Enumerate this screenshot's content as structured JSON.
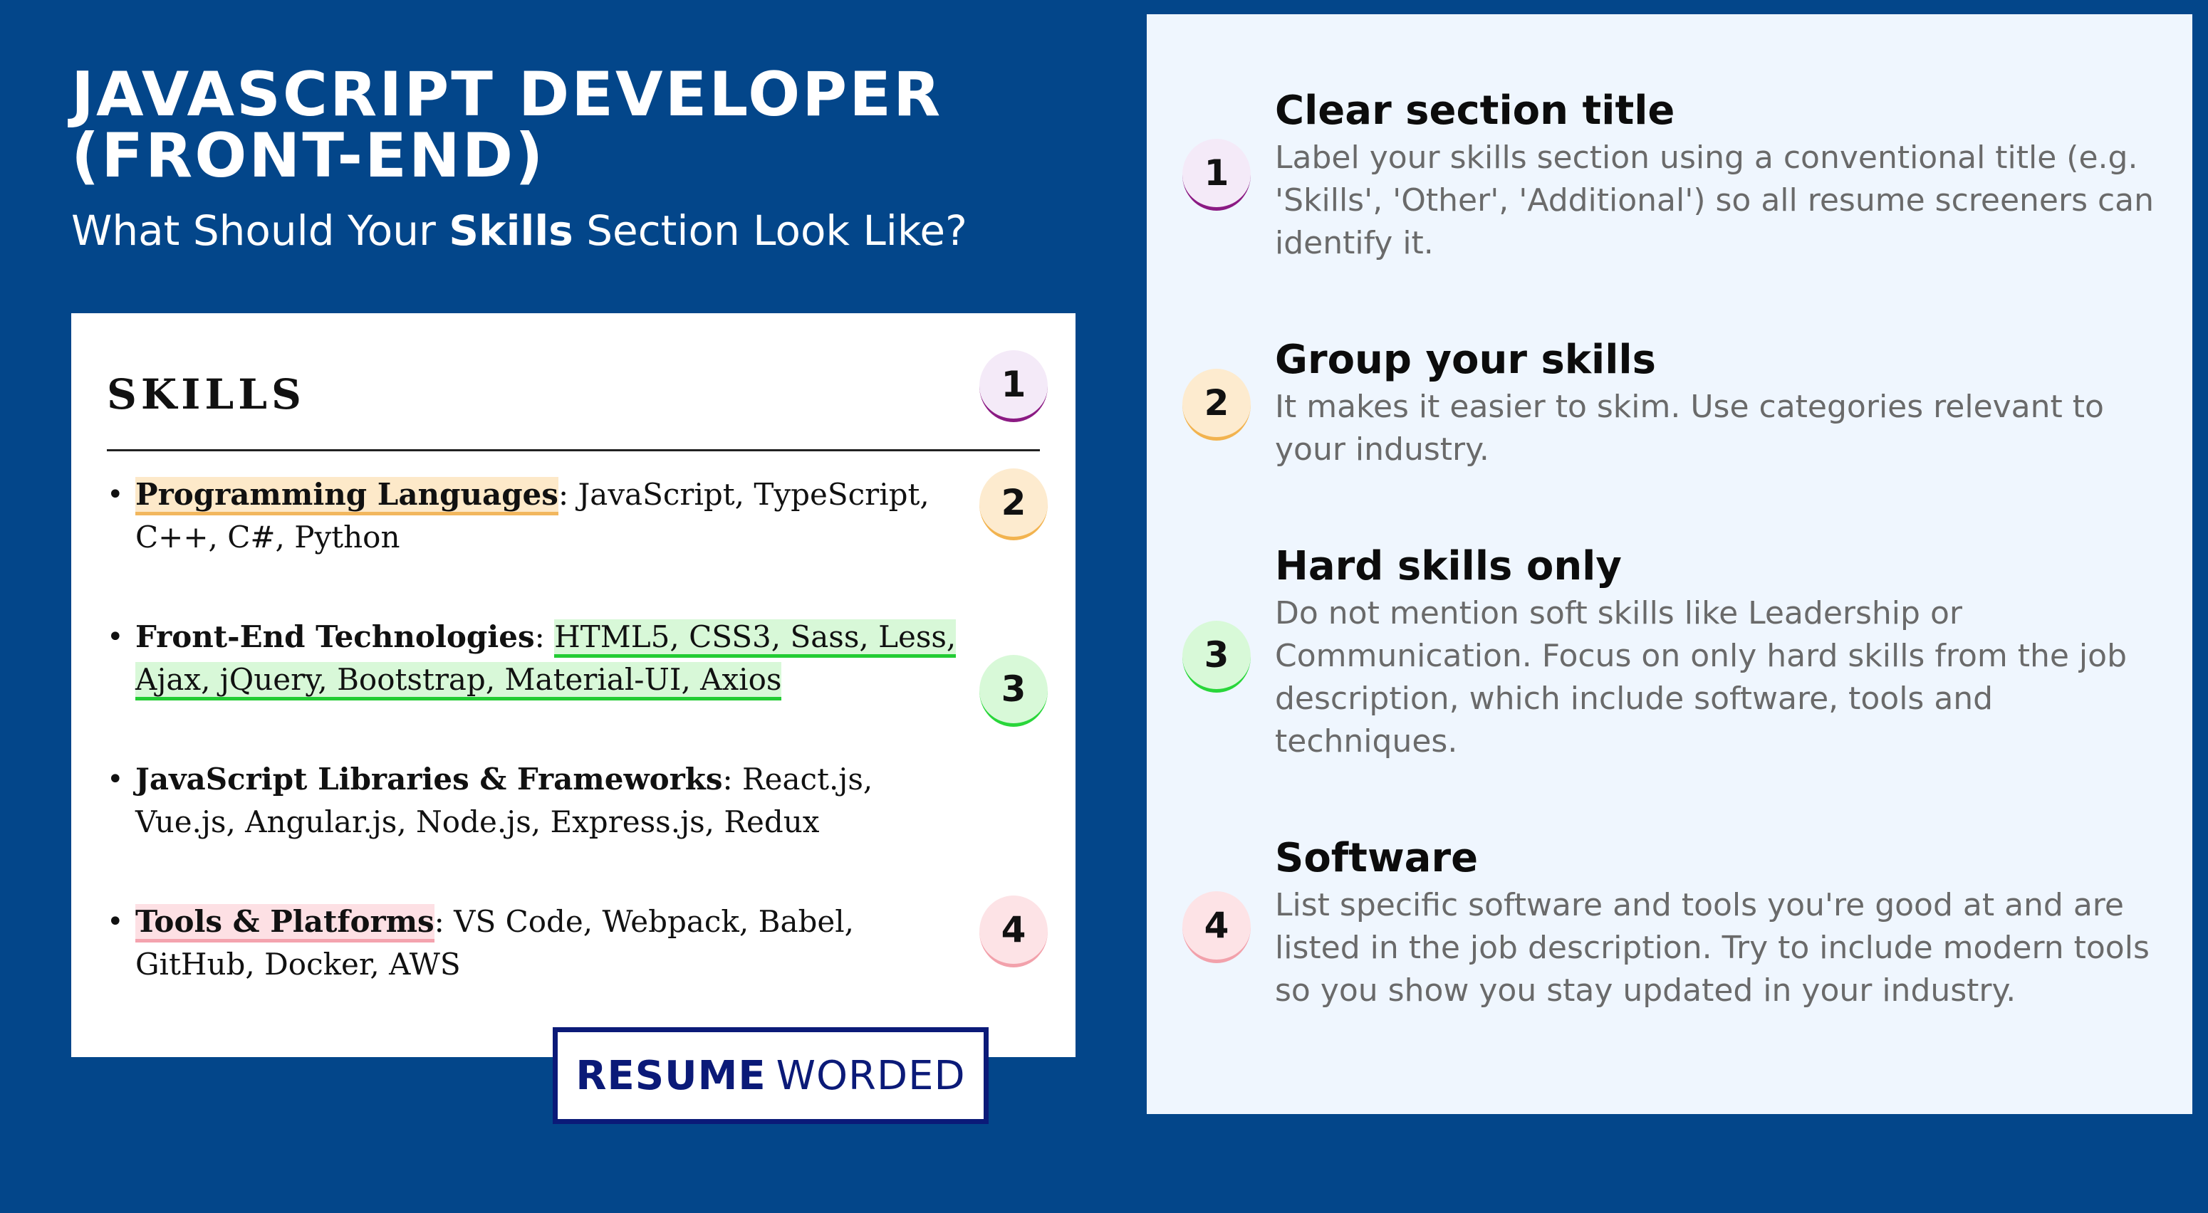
{
  "header": {
    "title": "JAVASCRIPT DEVELOPER (FRONT-END)",
    "subtitle_pre": "What Should Your ",
    "subtitle_bold": "Skills",
    "subtitle_post": " Section Look Like?"
  },
  "resume": {
    "heading": "SKILLS",
    "items": [
      {
        "label": "Programming Languages",
        "text": ": JavaScript, TypeScript, C++, C#, Python"
      },
      {
        "label": "Front-End Technologies",
        "sep": ": ",
        "text": "HTML5, CSS3, Sass, Less, Ajax, jQuery, Bootstrap, Material-UI, Axios"
      },
      {
        "label": "JavaScript Libraries & Frameworks",
        "text": ": React.js, Vue.js, Angular.js, Node.js, Express.js, Redux"
      },
      {
        "label": "Tools & Platforms",
        "text": ": VS Code, Webpack, Babel, GitHub, Docker, AWS"
      }
    ],
    "badges": [
      "1",
      "2",
      "3",
      "4"
    ]
  },
  "logo": {
    "strong": "RESUME",
    "light": "WORDED"
  },
  "colors": {
    "background": "#03468a",
    "panel": "#eff6fe",
    "badge1": "#8b1a83",
    "badge2": "#f2b34f",
    "badge3": "#29d63a",
    "badge4": "#f2a1ab"
  },
  "tips": [
    {
      "number": "1",
      "title": "Clear section title",
      "text": "Label your skills section using a conventional title (e.g. 'Skills', 'Other', 'Additional') so all resume screeners can identify it."
    },
    {
      "number": "2",
      "title": "Group your skills",
      "text": "It makes it easier to skim. Use categories relevant to your industry."
    },
    {
      "number": "3",
      "title": "Hard skills only",
      "text": "Do not mention soft skills like Leadership or Communication. Focus on only hard skills from the job description, which include software, tools and techniques."
    },
    {
      "number": "4",
      "title": "Software",
      "text": "List specific software and tools you're good at and are listed in the job description. Try to include modern tools so you show you stay updated in your industry."
    }
  ]
}
